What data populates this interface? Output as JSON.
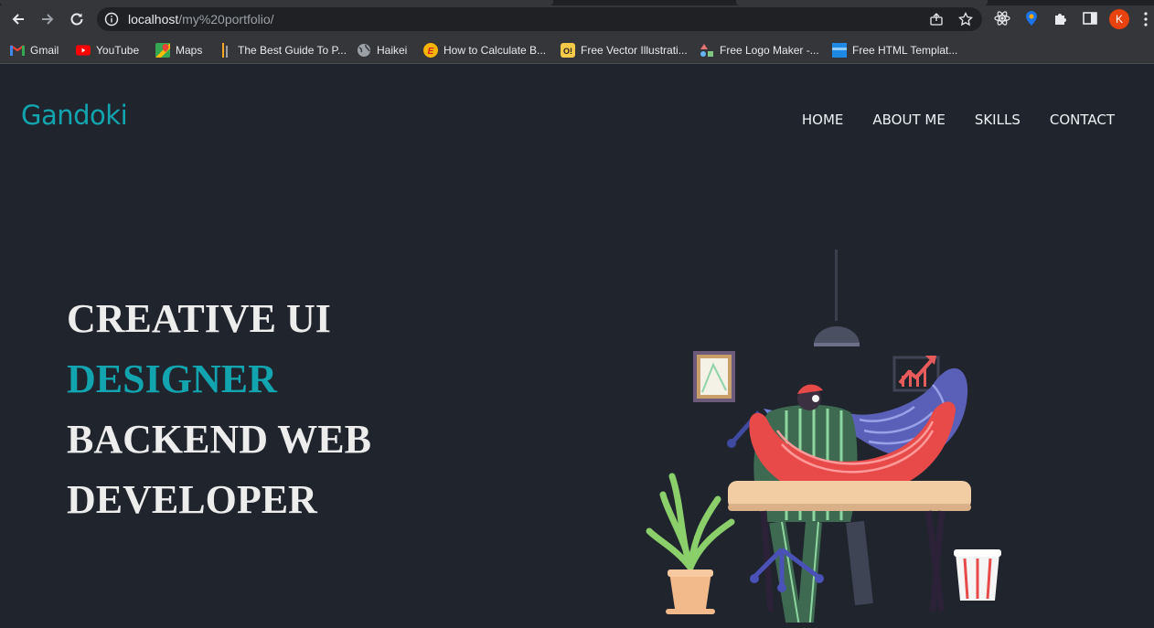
{
  "browser": {
    "url_host": "localhost",
    "url_path": "/my%20portfolio/",
    "profile_initial": "K",
    "bookmarks": [
      {
        "label": "Gmail",
        "icon": "gmail-icon"
      },
      {
        "label": "YouTube",
        "icon": "youtube-icon"
      },
      {
        "label": "Maps",
        "icon": "maps-icon"
      },
      {
        "label": "The Best Guide To P...",
        "icon": "bookmark-icon"
      },
      {
        "label": "Haikei",
        "icon": "globe-icon"
      },
      {
        "label": "How to Calculate B...",
        "icon": "etsy-icon"
      },
      {
        "label": "Free Vector Illustrati...",
        "icon": "ouch-icon"
      },
      {
        "label": "Free Logo Maker -...",
        "icon": "shapes-icon"
      },
      {
        "label": "Free HTML Templat...",
        "icon": "template-icon"
      }
    ]
  },
  "site": {
    "logo": "Gandoki",
    "nav": [
      "HOME",
      "ABOUT ME",
      "SKILLS",
      "CONTACT"
    ],
    "hero": {
      "line1": "CREATIVE UI",
      "line2": "DESIGNER",
      "line3": "BACKEND WEB",
      "line4": "DEVELOPER"
    }
  },
  "colors": {
    "accent": "#12a5b0",
    "page_background": "#1f242d",
    "chrome_background": "#35363a"
  }
}
